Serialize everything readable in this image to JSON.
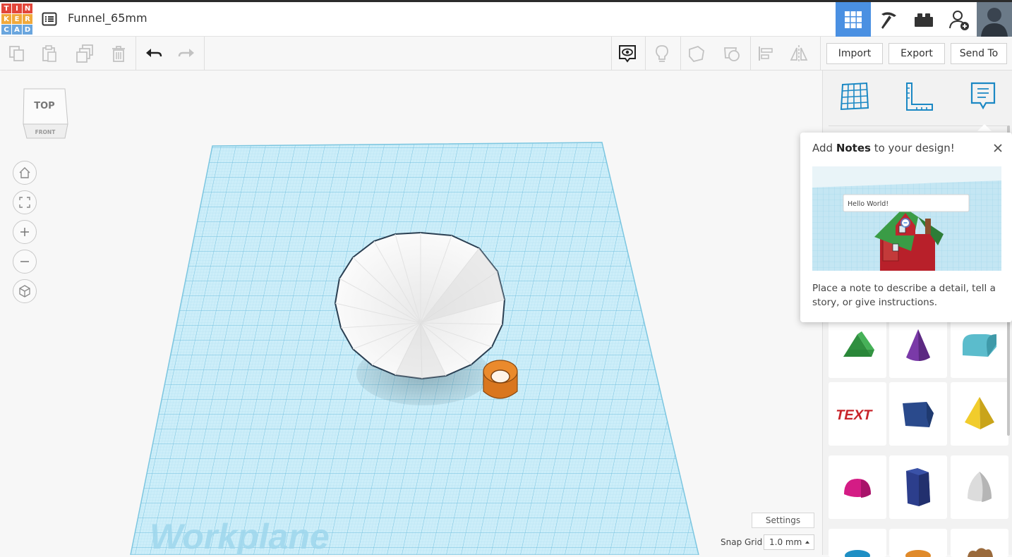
{
  "app": {
    "logo_letters": [
      "T",
      "I",
      "N",
      "K",
      "E",
      "R",
      "C",
      "A",
      "D"
    ],
    "logo_colors": [
      "#e2463a",
      "#e2463a",
      "#e2463a",
      "#f0a93b",
      "#f0a93b",
      "#f0a93b",
      "#6aa6de",
      "#6aa6de",
      "#6aa6de"
    ],
    "design_name": "Funnel_65mm",
    "accent": "#4a90e2"
  },
  "header_icons": [
    "grid-view-icon",
    "pickaxe-icon",
    "bricks-icon",
    "add-user-icon",
    "avatar"
  ],
  "toolbar": {
    "left_tools": [
      "copy-icon",
      "paste-icon",
      "duplicate-icon",
      "delete-icon",
      "undo-icon",
      "redo-icon"
    ],
    "right_tools": [
      "notes-visibility-icon",
      "light-bulb-icon",
      "solid-shape-icon",
      "hole-shape-icon",
      "align-icon",
      "mirror-icon"
    ],
    "import_label": "Import",
    "export_label": "Export",
    "send_to_label": "Send To"
  },
  "viewcube": {
    "top_label": "TOP",
    "front_label": "FRONT"
  },
  "nav_buttons": [
    "home-view-icon",
    "fit-all-icon",
    "zoom-in-icon",
    "zoom-out-icon",
    "perspective-icon"
  ],
  "canvas": {
    "workplane_label": "Workplane",
    "grid_color": "#8fd1ea",
    "settings_label": "Settings",
    "snap_grid_label": "Snap Grid",
    "snap_grid_value": "1.0 mm"
  },
  "right_panel": {
    "tabs": [
      "workplane-tab-icon",
      "ruler-tab-icon",
      "notes-tab-icon"
    ],
    "shapes": [
      "wedge",
      "cone",
      "half-cylinder",
      "text",
      "polygon",
      "pyramid",
      "half-sphere",
      "hexagonal-prism",
      "paraboloid"
    ],
    "shape_colors": [
      "#3aa349",
      "#7a3aa8",
      "#5bbccc",
      "#c8252b",
      "#2a4a8c",
      "#e8c325",
      "#d41c85",
      "#2c3e8c",
      "#d8d8d8"
    ],
    "partial_shape_colors": [
      "#1f8fc4",
      "#e08a2a",
      "#9a6a3c"
    ]
  },
  "notes_popover": {
    "title_prefix": "Add ",
    "title_bold": "Notes",
    "title_suffix": " to your design!",
    "image_caption": "Hello World!",
    "body": "Place a note to describe a detail, tell a story, or give instructions."
  }
}
